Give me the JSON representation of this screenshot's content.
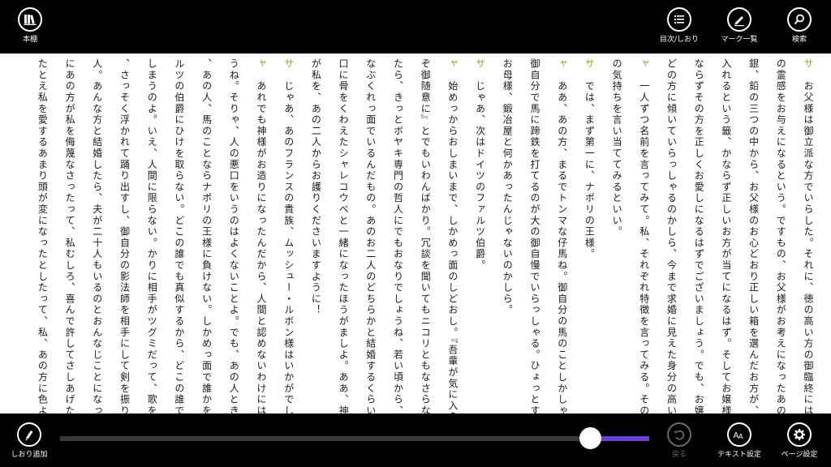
{
  "top_bar": {
    "bookshelf_label": "本棚",
    "toc_bookmark_label": "目次/しおり",
    "marker_list_label": "マーク一覧",
    "search_label": "検索"
  },
  "bottom_bar": {
    "add_bookmark_label": "しおり追加",
    "back_label": "戻る",
    "text_settings_label": "テキスト設定",
    "page_settings_label": "ページ設定"
  },
  "reading_progress": 0.9,
  "colors": {
    "bar_background": "#000000",
    "speaker_mark": "#9aa21e",
    "slider_fill": "#6a3fd6"
  },
  "page_columns": [
    {
      "speaker": "サ",
      "text": "お父様は御立派な方でいらした。それに、徳の高い方の御臨終には、神様"
    },
    {
      "speaker": "",
      "text": "の霊感をお与えになるという。ですもの、お父様がお考えになったあの箱選び"
    },
    {
      "speaker": "",
      "text": "銀、鉛の三つの中から、お父様のお心どおり正しい箱を選んだお方が、お嬢様"
    },
    {
      "speaker": "",
      "text": "入れるという籤、かならず正しいお方が当てになるはず。そしてお嬢様御自身"
    },
    {
      "speaker": "",
      "text": "ならずその方を正しくお愛しになるはずでございましょう。でも、お嬢様の御"
    },
    {
      "speaker": "",
      "text": "どの方に傾いていらっしゃるのかしら、今まで求婚に見えた身分の高い殿方の"
    },
    {
      "speaker": "ャ",
      "text": "一人ずつ名前を言ってみて。私、それぞれ特徴を言ってみる。その口ぶり"
    },
    {
      "speaker": "",
      "text": "の気持ちを言い当ててみるといい。"
    },
    {
      "speaker": "サ",
      "text": "では、まず第一に、ナポリの王様。"
    },
    {
      "speaker": "ャ",
      "text": "ああ、あの方、まるでトンマな仔馬ね。御自分の馬のことしかしゃべらない"
    },
    {
      "speaker": "",
      "text": "御自分で馬に蹄鉄を打てるのが大の御自慢でいらっしゃる。ひょっとする"
    },
    {
      "speaker": "",
      "text": "お母様、鍛冶屋と何かあったんじゃないのかしら。"
    },
    {
      "speaker": "サ",
      "text": "じゃあ、次はドイツのファルツ伯爵。"
    },
    {
      "speaker": "ャ",
      "text": "始めっからおしまいまで、しかめっ面のしどおし。『吾輩が気に入らぬなら"
    },
    {
      "speaker": "",
      "text": "ぞ御随意に』とでもいわんばかり。冗談を聞いてもニコリともなさらない。輪"
    },
    {
      "speaker": "",
      "text": "たら、きっとボヤキ専門の哲人にでもおなりでしょうね、若い頃から、あんな"
    },
    {
      "speaker": "",
      "text": "なぶくれっ面でいるんだもの。あのお二人のどちらかと結婚するくらいなら、"
    },
    {
      "speaker": "",
      "text": "口に骨をくわえたシャレコウベと一緒になったほうがましよ。ああ、神様"
    },
    {
      "speaker": "",
      "text": "が私を、あの二人からお護りくださいますように！"
    },
    {
      "speaker": "サ",
      "text": "じゃあ、あのフランスの貴族、ムッシュー・ルボン様はいかがでしょう。"
    },
    {
      "speaker": "ャ",
      "text": "あれでも神様がお造りになったんだから、人間と認めないわけにはゆかない"
    },
    {
      "speaker": "",
      "text": "うね。そりゃ、人の悪口をいうのはよくないことよ。でも、あの人ときたら"
    },
    {
      "speaker": "",
      "text": "、あの人、馬のことならナポリの王様に負けない。しかめっ面で誰かを睨む"
    },
    {
      "speaker": "",
      "text": "ルツの伯爵にひけを取らない。どこの誰でも真似するから、どこの誰でもな"
    },
    {
      "speaker": "",
      "text": "しまうのよ。いえ、人間に限らない。かりに相手がツグミだって、歌を"
    },
    {
      "speaker": "",
      "text": "、さっそく浮かれて踊り出すし、御自分の影法師を相手にして剣を振り回"
    },
    {
      "speaker": "",
      "text": "人。あんな方と結婚したら、夫が二十人もいるのとおんなじことになって"
    },
    {
      "speaker": "",
      "text": "にあの方が私を侮蔑なさったって、私むしろ、喜んで許してさしあげたいわ。"
    },
    {
      "speaker": "",
      "text": "たとえ私を愛するあまり頭が変になったとしたって、私、あの方に色よい返事"
    }
  ]
}
